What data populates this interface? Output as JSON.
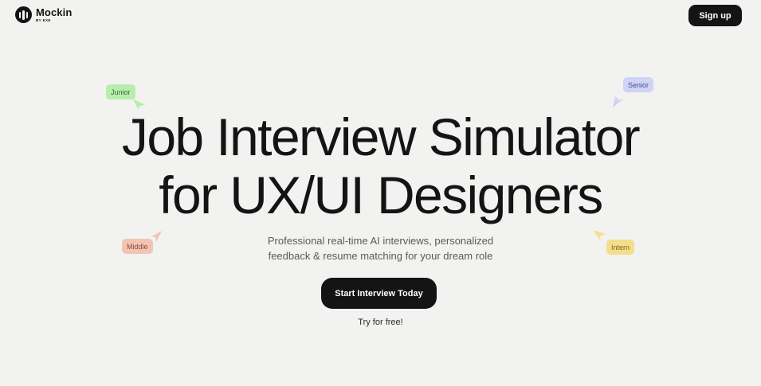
{
  "header": {
    "brand_name": "Mockin",
    "brand_sub": "BY EXE",
    "signup_label": "Sign up"
  },
  "hero": {
    "title_line1": "Job Interview Simulator",
    "title_line2": "for UX/UI Designers",
    "subtitle_line1": "Professional real-time AI interviews, personalized",
    "subtitle_line2": "feedback & resume matching for your dream role",
    "cta_label": "Start Interview Today",
    "cta_note": "Try for free!"
  },
  "tags": {
    "junior": "Junior",
    "senior": "Senior",
    "middle": "Middle",
    "intern": "Intern"
  },
  "colors": {
    "background": "#f2f2f1",
    "primary": "#141414",
    "junior": "#b7edad",
    "senior": "#cfd3f7",
    "middle": "#f4c4b3",
    "intern": "#f5de8b"
  },
  "icons": {
    "logo": "soundwave-logo-icon",
    "cursor": "pointer-arrow-icon"
  }
}
